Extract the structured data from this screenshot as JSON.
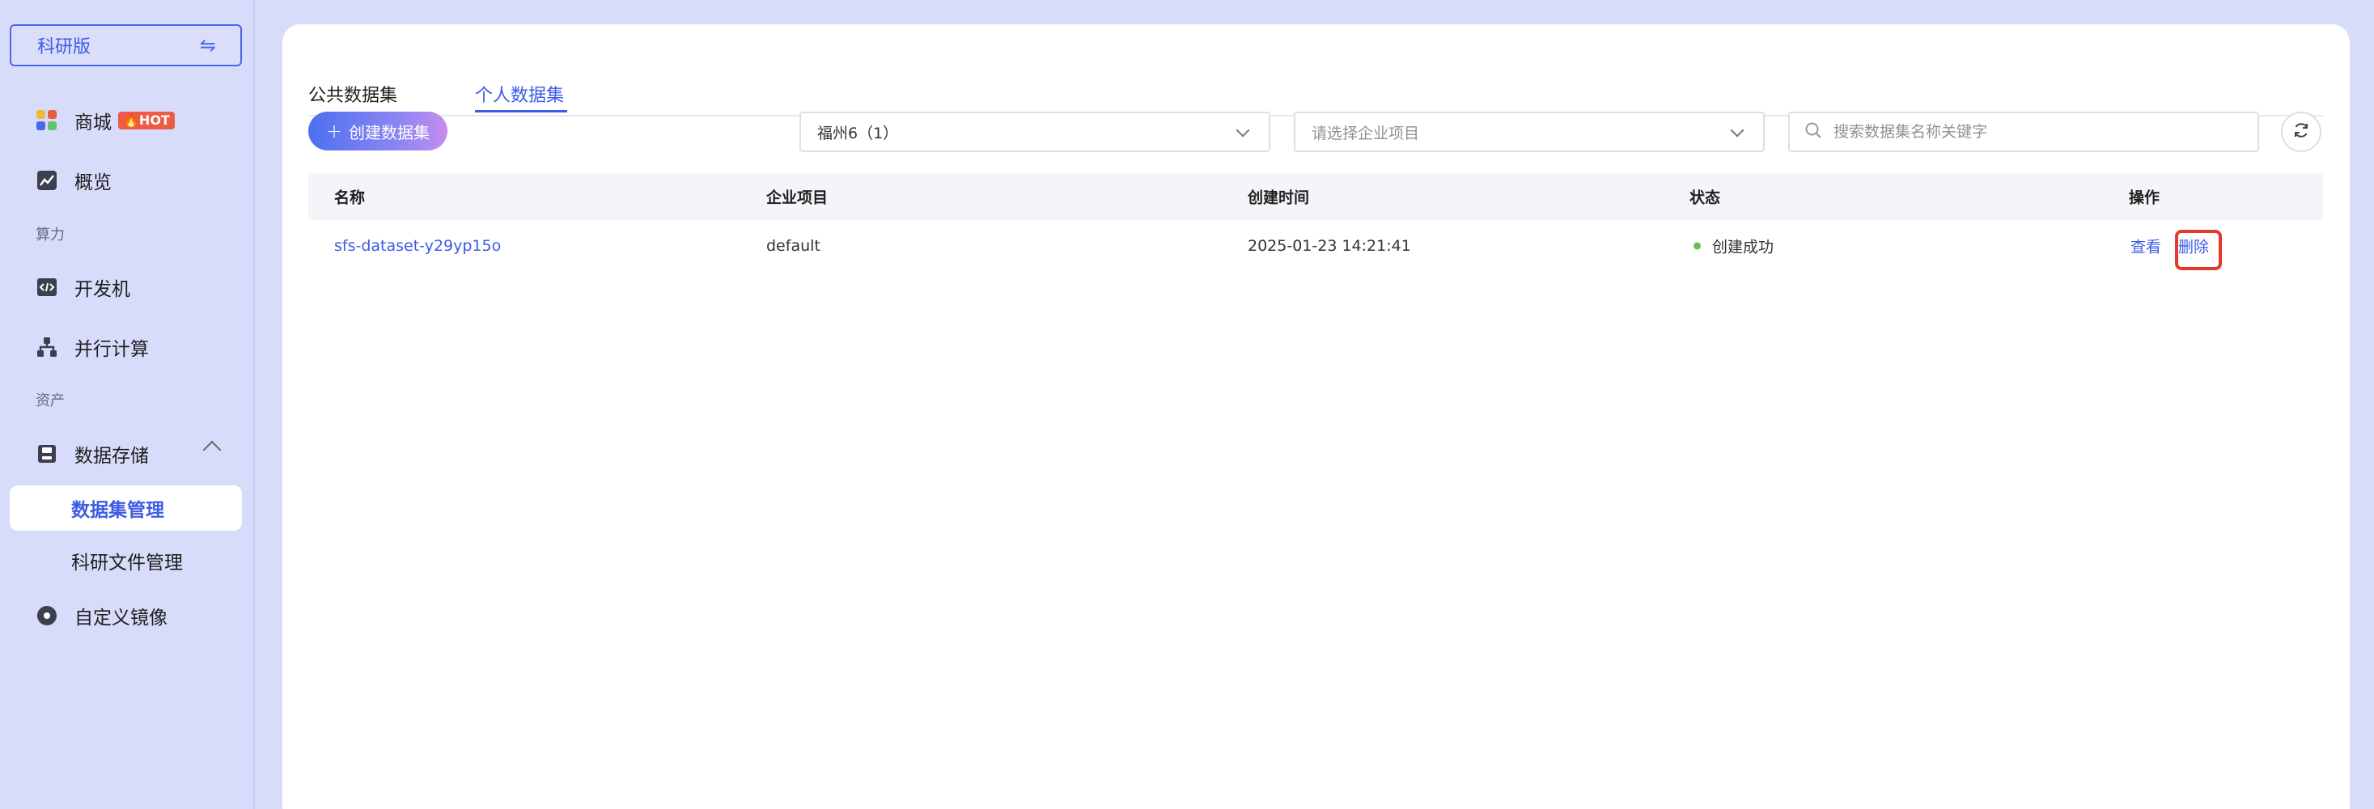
{
  "sidebar": {
    "edition_label": "科研版",
    "swap_glyph": "⇋",
    "items": [
      {
        "label": "商城",
        "badge": "HOT",
        "icon": "apps-grid-icon"
      },
      {
        "label": "概览",
        "icon": "chart-line-icon"
      },
      {
        "label": "开发机",
        "icon": "code-window-icon"
      },
      {
        "label": "并行计算",
        "icon": "hierarchy-icon"
      },
      {
        "label": "数据存储",
        "icon": "storage-icon"
      },
      {
        "label": "自定义镜像",
        "icon": "disc-icon"
      }
    ],
    "sections": [
      "算力",
      "资产"
    ],
    "submenu": [
      {
        "label": "数据集管理",
        "active": true
      },
      {
        "label": "科研文件管理",
        "active": false
      }
    ]
  },
  "tabs": [
    {
      "label": "公共数据集",
      "active": false
    },
    {
      "label": "个人数据集",
      "active": true
    }
  ],
  "toolbar": {
    "create_label": "创建数据集",
    "region_select_value": "福州6（1）",
    "project_select_placeholder": "请选择企业项目",
    "search_placeholder": "搜索数据集名称关键字"
  },
  "table": {
    "columns": [
      "名称",
      "企业项目",
      "创建时间",
      "状态",
      "操作"
    ],
    "rows": [
      {
        "name": "sfs-dataset-y29yp15o",
        "project": "default",
        "created": "2025-01-23 14:21:41",
        "status": "创建成功",
        "actions": [
          "查看",
          "删除"
        ]
      }
    ]
  },
  "colors": {
    "accent": "#3d5be3",
    "status_success": "#6abf4b",
    "highlight": "#e43a2d",
    "hot_badge": "#ee5b45"
  }
}
